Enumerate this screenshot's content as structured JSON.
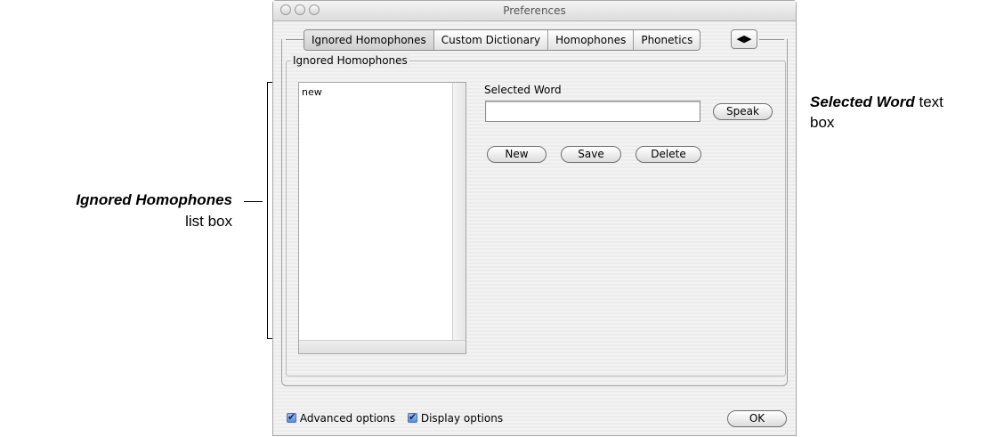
{
  "window": {
    "title": "Preferences"
  },
  "tabs": [
    {
      "label": "Ignored Homophones",
      "selected": true
    },
    {
      "label": "Custom Dictionary",
      "selected": false
    },
    {
      "label": "Homophones",
      "selected": false
    },
    {
      "label": "Phonetics",
      "selected": false
    }
  ],
  "tab_scroll_icon": "◀▶",
  "group": {
    "label": "Ignored Homophones",
    "list_items": [
      "new"
    ]
  },
  "selected_word": {
    "label": "Selected Word",
    "value": ""
  },
  "buttons": {
    "speak": "Speak",
    "new": "New",
    "save": "Save",
    "delete": "Delete",
    "ok": "OK"
  },
  "footer": {
    "advanced_options": {
      "label": "Advanced options",
      "checked": true
    },
    "display_options": {
      "label": "Display options",
      "checked": true
    }
  },
  "annotations": {
    "list_box": {
      "bold": "Ignored Homophones",
      "rest": "list box"
    },
    "text_box": {
      "bold": "Selected Word",
      "rest1": " text",
      "rest2": "box"
    }
  }
}
